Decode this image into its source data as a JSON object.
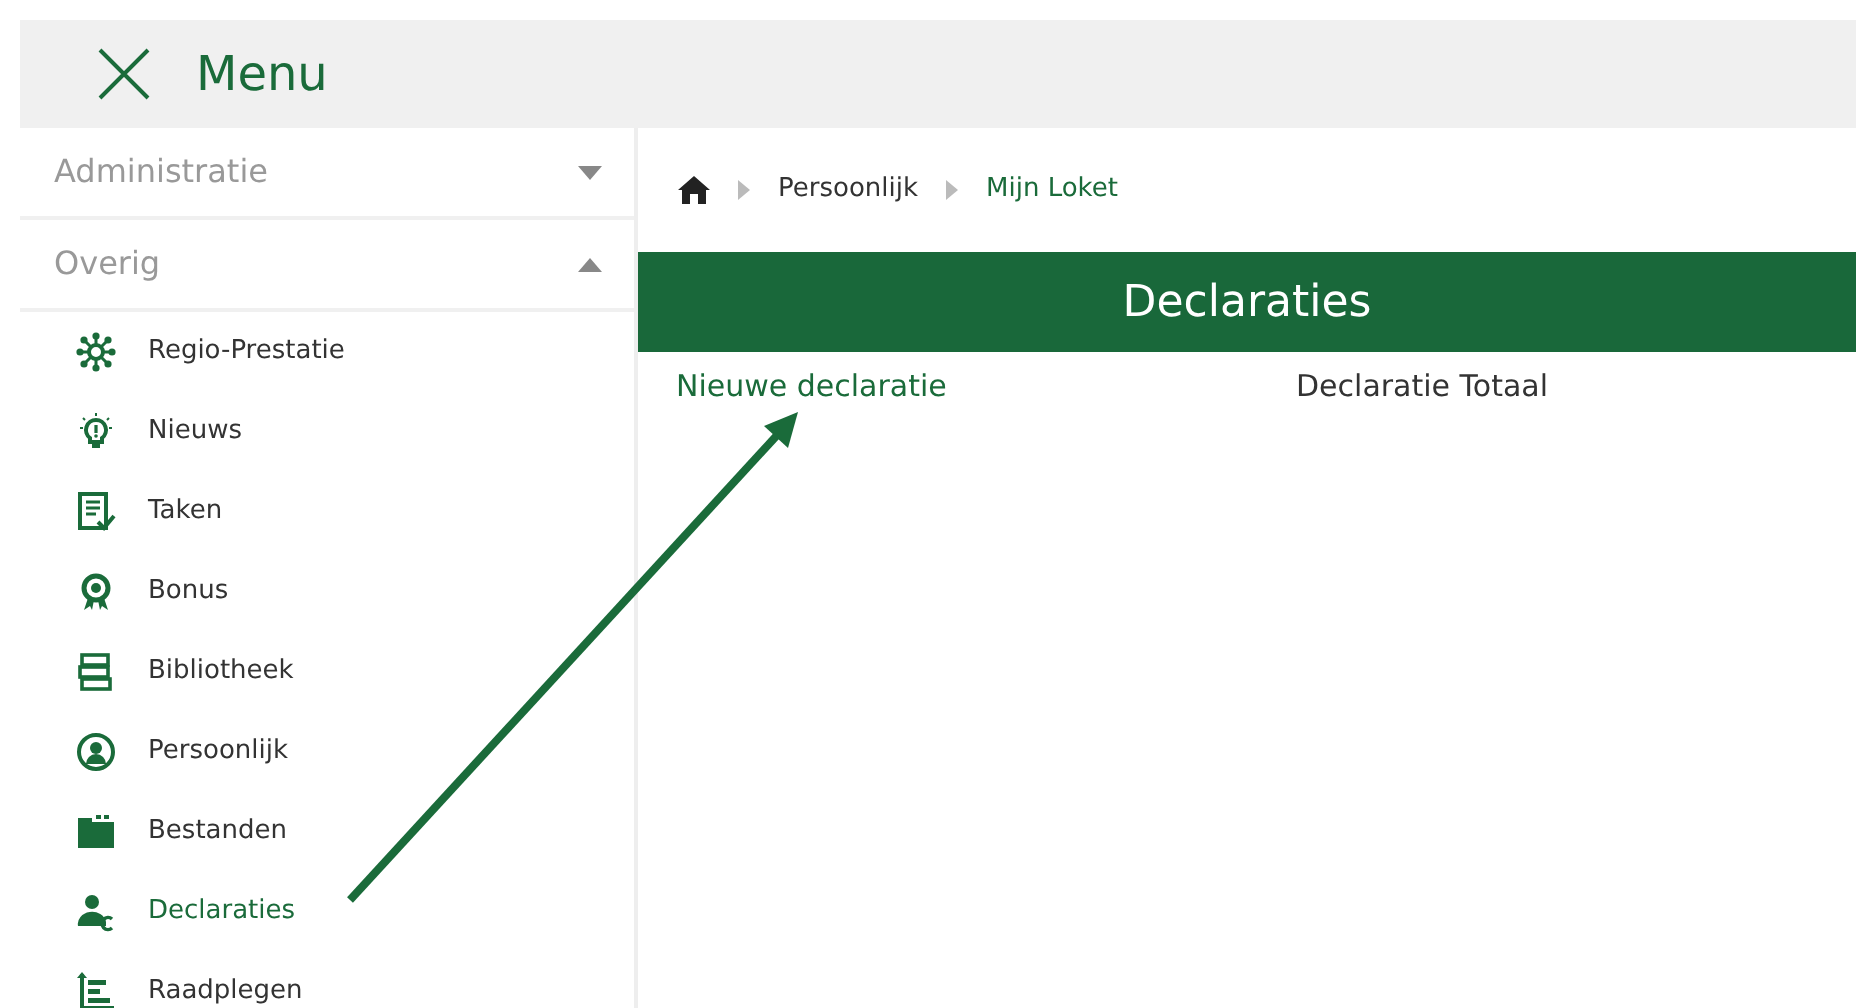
{
  "menu": {
    "title": "Menu"
  },
  "sidebar": {
    "sections": [
      {
        "label": "Administratie",
        "expanded": false
      },
      {
        "label": "Overig",
        "expanded": true,
        "items": [
          {
            "label": "Regio-Prestatie",
            "selected": false
          },
          {
            "label": "Nieuws",
            "selected": false
          },
          {
            "label": "Taken",
            "selected": false
          },
          {
            "label": "Bonus",
            "selected": false
          },
          {
            "label": "Bibliotheek",
            "selected": false
          },
          {
            "label": "Persoonlijk",
            "selected": false
          },
          {
            "label": "Bestanden",
            "selected": false
          },
          {
            "label": "Declaraties",
            "selected": true
          },
          {
            "label": "Raadplegen",
            "selected": false
          }
        ]
      }
    ]
  },
  "breadcrumb": [
    {
      "label": "Persoonlijk",
      "current": false
    },
    {
      "label": "Mijn Loket",
      "current": true
    }
  ],
  "page": {
    "title": "Declaraties",
    "links": [
      {
        "label": "Nieuwe declaratie",
        "kind": "primary"
      },
      {
        "label": "Declaratie Totaal",
        "kind": "plain"
      }
    ]
  }
}
